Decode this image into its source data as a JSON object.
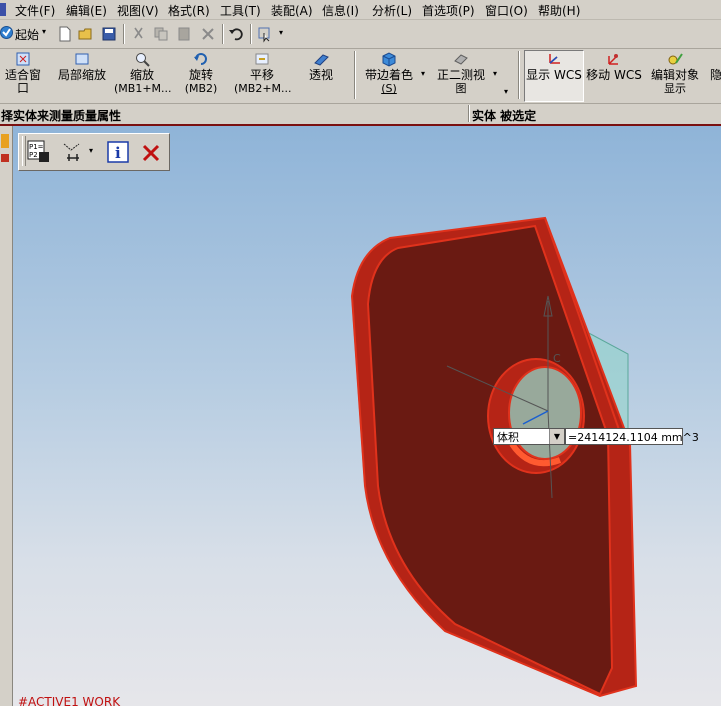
{
  "menu": [
    "文件(F)",
    "编辑(E)",
    "视图(V)",
    "格式(R)",
    "工具(T)",
    "装配(A)",
    "信息(I)",
    "分析(L)",
    "首选项(P)",
    "窗口(O)",
    "帮助(H)"
  ],
  "toolbar1": {
    "start_label": "起始"
  },
  "toolbar2": {
    "buttons": [
      {
        "label": "适合窗口",
        "sub": ""
      },
      {
        "label": "局部缩放",
        "sub": ""
      },
      {
        "label": "缩放",
        "sub": "(MB1+M..."
      },
      {
        "label": "旋转",
        "sub": "(MB2)"
      },
      {
        "label": "平移",
        "sub": "(MB2+M..."
      },
      {
        "label": "透视",
        "sub": ""
      },
      {
        "label": "带边着色",
        "sub": "(S)"
      },
      {
        "label": "正二测视",
        "sub": "图"
      },
      {
        "label": "显示 WCS",
        "sub": ""
      },
      {
        "label": "移动 WCS",
        "sub": ""
      },
      {
        "label": "编辑对象",
        "sub": "显示"
      },
      {
        "label": "隐",
        "sub": ""
      }
    ]
  },
  "status": {
    "prompt": "择实体来测量质量属性",
    "selection": "实体 被选定"
  },
  "measure": {
    "option": "体积",
    "value": "=2414124.1104 mm^3"
  },
  "viewport": {
    "work_label": "#ACTIVE1 WORK",
    "axis_label": "C"
  },
  "colors": {
    "part": "#6a1a12",
    "part_edge": "#e0321c",
    "plane": "#8fd6c8"
  }
}
